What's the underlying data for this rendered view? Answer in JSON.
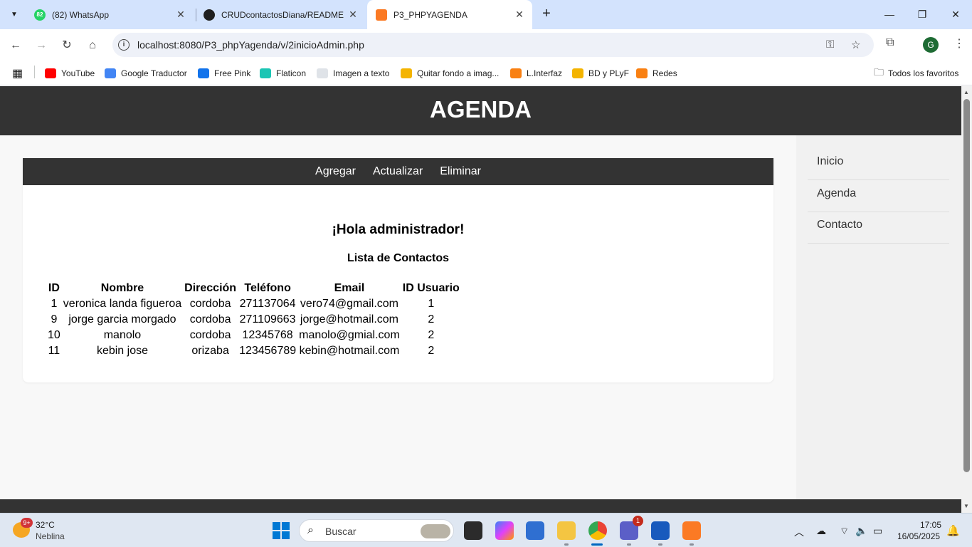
{
  "browser": {
    "tabs": [
      {
        "title": "(82) WhatsApp",
        "badge": "82",
        "icon": "whatsapp-icon",
        "color": "#25d366"
      },
      {
        "title": "CRUDcontactosDiana/README",
        "icon": "github-icon",
        "color": "#1f1f1f"
      },
      {
        "title": "P3_PHPYAGENDA",
        "icon": "xampp-icon",
        "color": "#fb7a24",
        "active": true
      }
    ],
    "url": "localhost:8080/P3_phpYagenda/v/2inicioAdmin.php",
    "profile_initial": "G",
    "bookmarks": [
      {
        "label": "YouTube",
        "icon": "youtube-icon",
        "color": "#ff0000"
      },
      {
        "label": "Google Traductor",
        "icon": "translate-icon",
        "color": "#4285f4"
      },
      {
        "label": "Free Pink",
        "icon": "freepik-icon",
        "color": "#1273eb"
      },
      {
        "label": "Flaticon",
        "icon": "flaticon-icon",
        "color": "#1bc5b4"
      },
      {
        "label": "Imagen a texto",
        "icon": "image-text-icon",
        "color": "#9aa0a6"
      },
      {
        "label": "Quitar fondo a imag...",
        "icon": "remove-bg-icon",
        "color": "#f4b400"
      },
      {
        "label": "L.Interfaz",
        "icon": "moodle-icon",
        "color": "#f98012"
      },
      {
        "label": "BD y PLyF",
        "icon": "bd-icon",
        "color": "#f4b400"
      },
      {
        "label": "Redes",
        "icon": "moodle-icon",
        "color": "#f98012"
      }
    ],
    "all_favorites": "Todos los favoritos"
  },
  "site": {
    "title": "AGENDA",
    "card_nav": [
      "Agregar",
      "Actualizar",
      "Eliminar"
    ],
    "greeting": "¡Hola administrador!",
    "list_title": "Lista de Contactos",
    "sidebar": [
      "Inicio",
      "Agenda",
      "Contacto"
    ]
  },
  "contacts": {
    "headers": [
      "ID",
      "Nombre",
      "Dirección",
      "Teléfono",
      "Email",
      "ID Usuario"
    ],
    "rows": [
      [
        "1",
        "veronica landa figueroa",
        "cordoba",
        "271137064",
        "vero74@gmail.com",
        "1"
      ],
      [
        "9",
        "jorge garcia morgado",
        "cordoba",
        "271109663",
        "jorge@hotmail.com",
        "2"
      ],
      [
        "10",
        "manolo",
        "cordoba",
        "12345768",
        "manolo@gmial.com",
        "2"
      ],
      [
        "11",
        "kebin jose",
        "orizaba",
        "123456789",
        "kebin@hotmail.com",
        "2"
      ]
    ]
  },
  "taskbar": {
    "weather_badge": "9+",
    "temperature": "32°C",
    "condition": "Neblina",
    "search_placeholder": "Buscar",
    "teams_badge": "1",
    "time": "17:05",
    "date": "16/05/2025"
  }
}
